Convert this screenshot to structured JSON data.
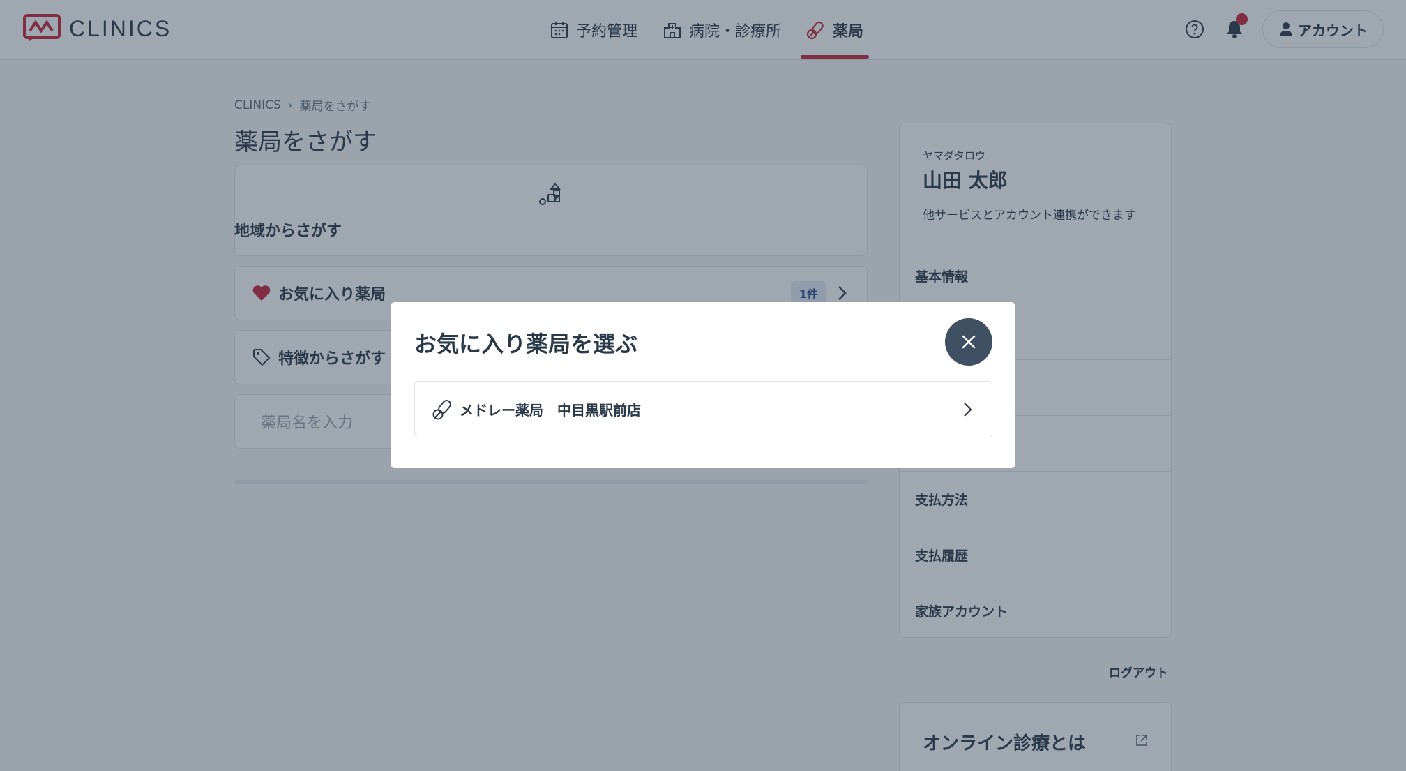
{
  "app": {
    "logo_text": "CLINICS"
  },
  "header": {
    "nav": [
      {
        "label": "予約管理",
        "icon": "calendar-icon"
      },
      {
        "label": "病院・診療所",
        "icon": "hospital-icon"
      },
      {
        "label": "薬局",
        "icon": "pill-icon",
        "active": true
      }
    ],
    "account_label": "アカウント"
  },
  "breadcrumb": {
    "root": "CLINICS",
    "current": "薬局をさがす"
  },
  "main": {
    "title": "薬局をさがす",
    "region_label": "地域からさがす",
    "favorite_label": "お気に入り薬局",
    "favorite_count": "1件",
    "feature_label": "特徴からさがす",
    "search_placeholder": "薬局名を入力"
  },
  "profile": {
    "kana": "ヤマダタロウ",
    "name": "山田 太郎",
    "link_note": "他サービスとアカウント連携ができます",
    "menu": [
      "基本情報",
      "",
      "",
      "",
      "支払方法",
      "支払履歴",
      "家族アカウント"
    ],
    "logout": "ログアウト",
    "online_title": "オンライン診療とは"
  },
  "modal": {
    "title": "お気に入り薬局を選ぶ",
    "items": [
      {
        "name": "メドレー薬局　中目黒駅前店"
      }
    ]
  },
  "colors": {
    "accent": "#c7243a",
    "text": "#2a3a48",
    "close_bg": "#3e5062"
  }
}
